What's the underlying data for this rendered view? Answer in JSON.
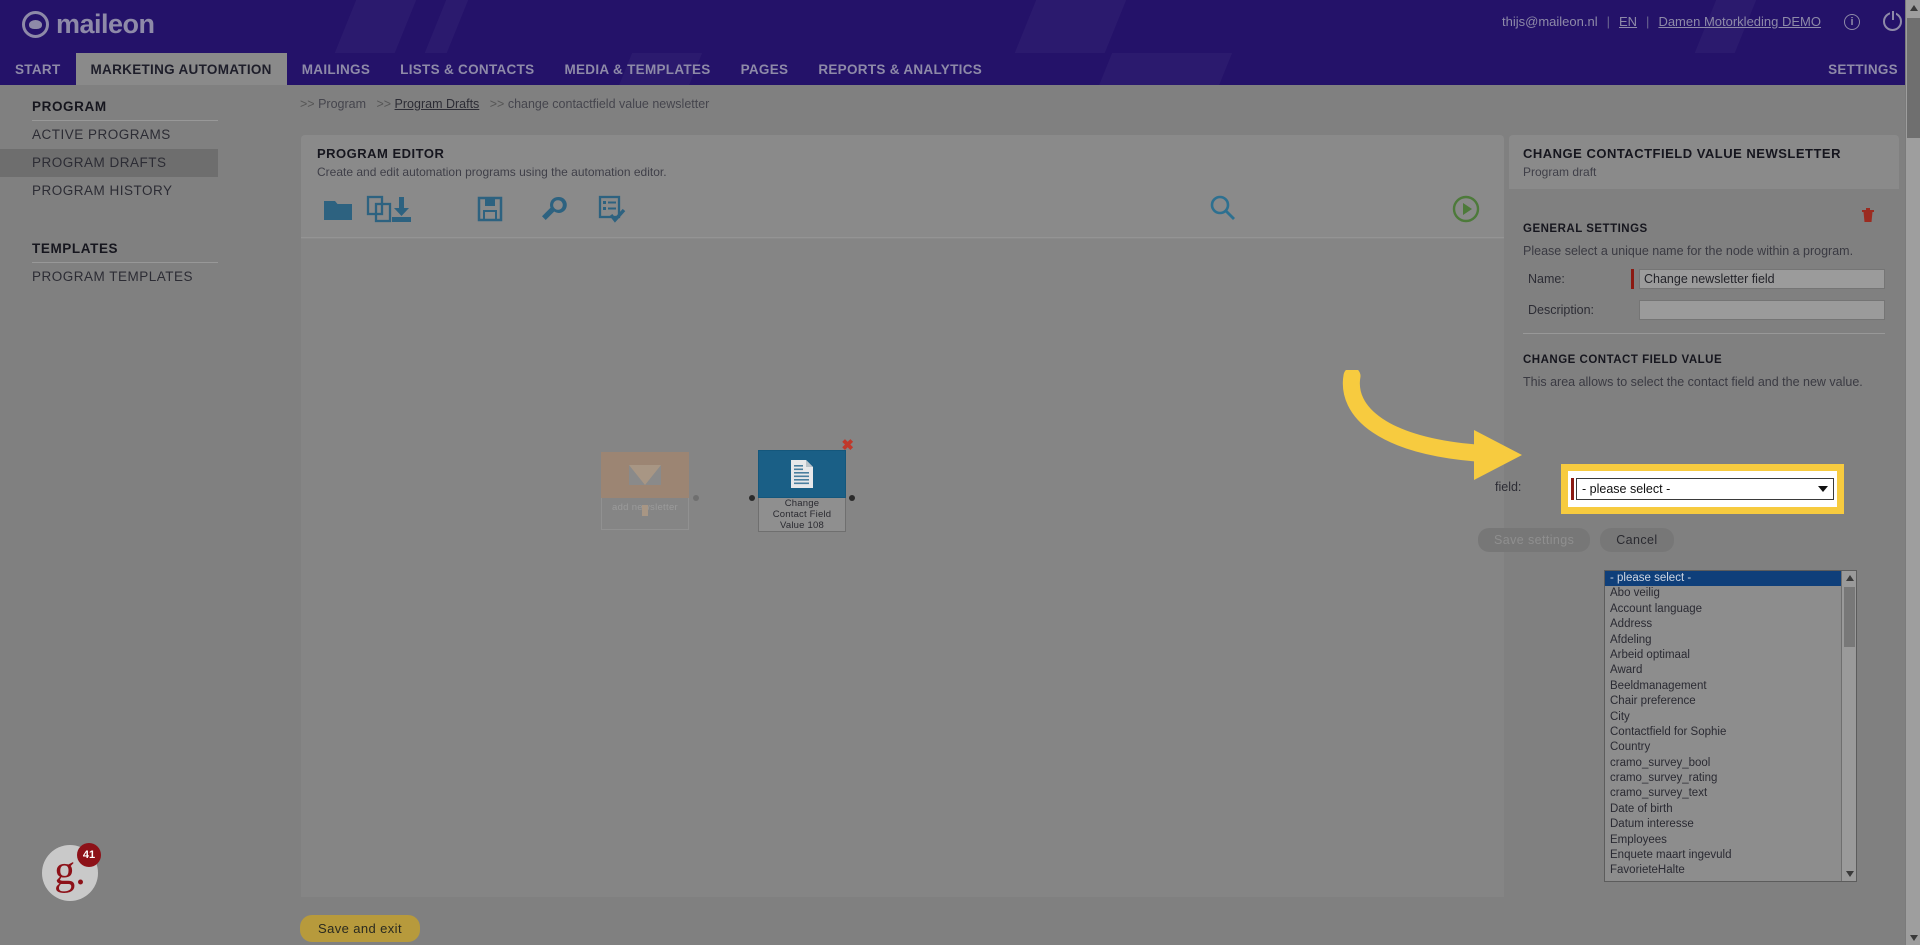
{
  "topbar": {
    "logo_text": "maileon",
    "user_email": "thijs@maileon.nl",
    "lang": "EN",
    "account": "Damen Motorkleding DEMO",
    "separator": "|",
    "info_icon": "info-icon",
    "power_icon": "power-icon"
  },
  "nav": {
    "items": [
      {
        "label": "START",
        "active": false
      },
      {
        "label": "MARKETING AUTOMATION",
        "active": true
      },
      {
        "label": "MAILINGS",
        "active": false
      },
      {
        "label": "LISTS & CONTACTS",
        "active": false
      },
      {
        "label": "MEDIA & TEMPLATES",
        "active": false
      },
      {
        "label": "PAGES",
        "active": false
      },
      {
        "label": "REPORTS & ANALYTICS",
        "active": false
      }
    ],
    "settings_label": "SETTINGS"
  },
  "sidebar": {
    "group1_title": "PROGRAM",
    "group1_items": [
      {
        "label": "ACTIVE PROGRAMS",
        "active": false
      },
      {
        "label": "PROGRAM DRAFTS",
        "active": true
      },
      {
        "label": "PROGRAM HISTORY",
        "active": false
      }
    ],
    "group2_title": "TEMPLATES",
    "group2_items": [
      {
        "label": "PROGRAM TEMPLATES",
        "active": false
      }
    ]
  },
  "breadcrumb": {
    "prefix": ">>",
    "item1": "Program",
    "item2": "Program Drafts",
    "item3": "change contactfield value newsletter"
  },
  "editor": {
    "title": "PROGRAM EDITOR",
    "subtitle": "Create and edit automation programs using the automation editor.",
    "toolbar": [
      {
        "name": "folder-icon",
        "label": "open"
      },
      {
        "name": "copy-icon",
        "label": "copy"
      },
      {
        "name": "download-icon",
        "label": "import"
      },
      {
        "name": "save-disk-icon",
        "label": "save"
      },
      {
        "name": "wrench-icon",
        "label": "tools"
      },
      {
        "name": "checklist-icon",
        "label": "validate"
      },
      {
        "name": "search-icon",
        "label": "search"
      },
      {
        "name": "play-icon",
        "label": "run"
      }
    ]
  },
  "canvas": {
    "node_ghost_label": "add newsletter",
    "node_selected_label": "Change\nContact Field\nValue 108",
    "node_selected_line1": "Change",
    "node_selected_line2": "Contact Field",
    "node_selected_line3": "Value 108",
    "close_icon": "close-icon"
  },
  "settings_panel": {
    "title": "CHANGE CONTACTFIELD VALUE NEWSLETTER",
    "subtitle": "Program draft",
    "trash_icon": "trash-icon",
    "general_section_title": "GENERAL SETTINGS",
    "general_section_desc": "Please select a unique name for the node within a program.",
    "name_label": "Name:",
    "name_value": "Change newsletter field",
    "description_label": "Description:",
    "description_value": "",
    "change_section_title": "CHANGE CONTACT FIELD VALUE",
    "change_section_desc": "This area allows to select the contact field and the new value.",
    "field_label": "field:",
    "field_selected": "- please select -",
    "save_label": "Save settings",
    "cancel_label": "Cancel"
  },
  "dropdown": {
    "options": [
      "- please select -",
      "Abo veilig",
      "Account language",
      "Address",
      "Afdeling",
      "Arbeid optimaal",
      "Award",
      "Beeldmanagement",
      "Chair preference",
      "City",
      "Contactfield for Sophie",
      "Country",
      "cramo_survey_bool",
      "cramo_survey_rating",
      "cramo_survey_text",
      "Date of birth",
      "Datum interesse",
      "Employees",
      "Enquete maart ingevuld",
      "FavorieteHalte"
    ],
    "selected_index": 0
  },
  "footer": {
    "save_and_exit": "Save and exit",
    "widget_letter": "g.",
    "widget_badge": "41"
  },
  "colors": {
    "brand_purple": "#241269",
    "accent_teal": "#2d6280",
    "node_blue": "#1a5f86",
    "highlight_yellow": "#f7cb3f",
    "save_button": "#b79a3c",
    "required_red": "#8b1a12",
    "selected_blue": "#0f3f7a"
  }
}
